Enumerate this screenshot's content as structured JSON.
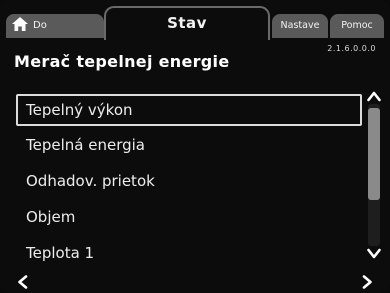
{
  "tabs": {
    "home": {
      "label": "Do",
      "icon": "home-icon"
    },
    "active": {
      "label": "Stav"
    },
    "settings": {
      "label": "Nastave"
    },
    "help": {
      "label": "Pomoc"
    }
  },
  "header": {
    "menu_id": "2.1.6.0.0.0",
    "title": "Merač tepelnej energie"
  },
  "list": {
    "items": [
      {
        "label": "Tepelný výkon",
        "selected": true
      },
      {
        "label": "Tepelná energia"
      },
      {
        "label": "Odhadov. prietok"
      },
      {
        "label": "Objem"
      },
      {
        "label": "Teplota 1"
      }
    ]
  },
  "scrollbar": {
    "up_icon": "chevron-up-icon",
    "down_icon": "chevron-down-icon"
  },
  "footer": {
    "back_icon": "chevron-left-icon",
    "forward_icon": "chevron-right-icon"
  },
  "colors": {
    "background": "#0c0c0c",
    "tab_inactive": "#5a5a5a",
    "text": "#f2f2f2",
    "selection_border": "#dcdcdc",
    "scroll_thumb": "#8a8a8a"
  }
}
